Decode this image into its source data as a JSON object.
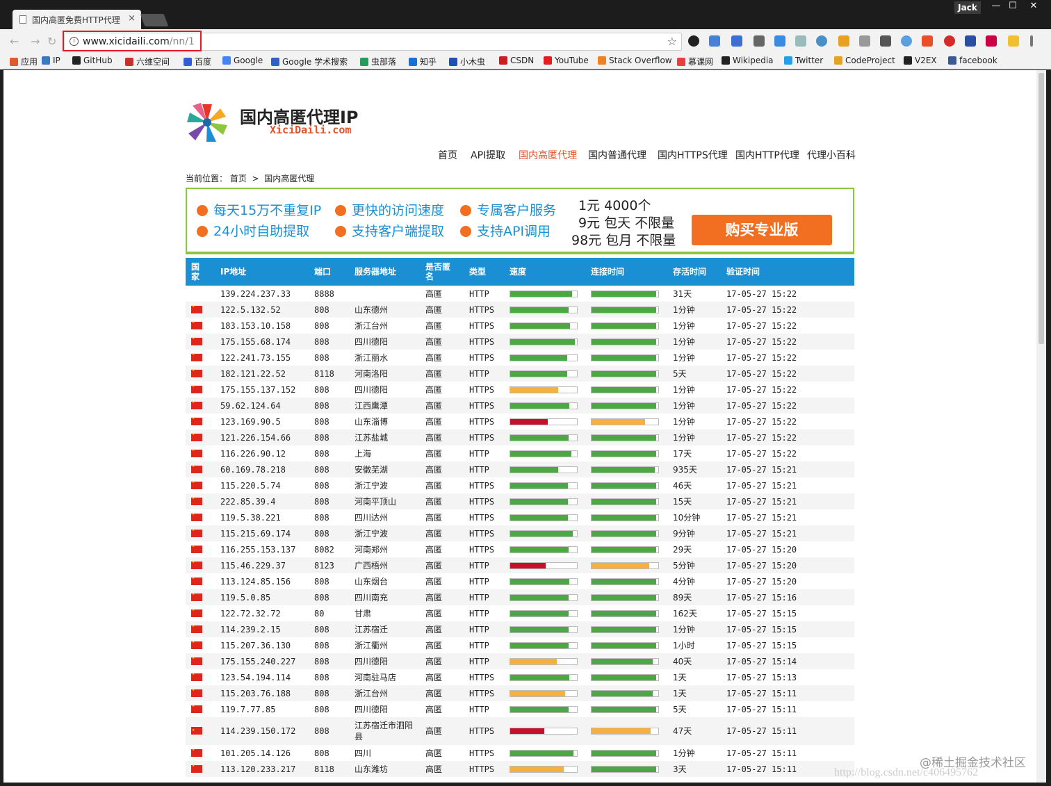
{
  "browser": {
    "tab_title": "国内高匿免费HTTP代理",
    "user": "Jack",
    "url_host": "www.xicidaili.com",
    "url_path": "/nn/1",
    "window_buttons": [
      "—",
      "☐",
      "✕"
    ],
    "bookmarks": [
      "应用",
      "IP",
      "GitHub",
      "六维空间",
      "百度",
      "Google",
      "Google 学术搜索",
      "虫部落",
      "知乎",
      "小木虫",
      "CSDN",
      "YouTube",
      "Stack Overflow",
      "慕课网",
      "Wikipedia",
      "Twitter",
      "CodeProject",
      "V2EX",
      "facebook"
    ]
  },
  "site": {
    "title": "国内高匿代理IP",
    "subtitle": "XiciDaili.com",
    "nav": [
      "首页",
      "API提取",
      "国内高匿代理",
      "国内普通代理",
      "国内HTTPS代理",
      "国内HTTP代理",
      "代理小百科"
    ],
    "breadcrumb_label": "当前位置：",
    "breadcrumb_home": "首页",
    "breadcrumb_sep": ">",
    "breadcrumb_current": "国内高匿代理"
  },
  "banner": {
    "features": [
      "每天15万不重复IP",
      "更快的访问速度",
      "专属客户服务",
      "24小时自助提取",
      "支持客户端提取",
      "支持API调用"
    ],
    "prices": [
      "1元 4000个",
      "9元 包天 不限量",
      "98元 包月 不限量"
    ],
    "buy_label": "购买专业版"
  },
  "table": {
    "headers": [
      "国家",
      "IP地址",
      "端口",
      "服务器地址",
      "是否匿名",
      "类型",
      "速度",
      "连接时间",
      "存活时间",
      "验证时间"
    ],
    "rows": [
      {
        "flag": false,
        "ip": "139.224.237.33",
        "port": "8888",
        "loc": "",
        "anon": "高匿",
        "type": "HTTP",
        "speed": 0.93,
        "speed_color": "green",
        "conn": 0.97,
        "conn_color": "green",
        "alive": "31天",
        "verified": "17-05-27 15:22"
      },
      {
        "flag": true,
        "ip": "122.5.132.52",
        "port": "808",
        "loc": "山东德州",
        "anon": "高匿",
        "type": "HTTPS",
        "speed": 0.88,
        "speed_color": "green",
        "conn": 0.97,
        "conn_color": "green",
        "alive": "1分钟",
        "verified": "17-05-27 15:22"
      },
      {
        "flag": true,
        "ip": "183.153.10.158",
        "port": "808",
        "loc": "浙江台州",
        "anon": "高匿",
        "type": "HTTPS",
        "speed": 0.9,
        "speed_color": "green",
        "conn": 0.97,
        "conn_color": "green",
        "alive": "1分钟",
        "verified": "17-05-27 15:22"
      },
      {
        "flag": true,
        "ip": "175.155.68.174",
        "port": "808",
        "loc": "四川德阳",
        "anon": "高匿",
        "type": "HTTPS",
        "speed": 0.97,
        "speed_color": "green",
        "conn": 0.97,
        "conn_color": "green",
        "alive": "1分钟",
        "verified": "17-05-27 15:22"
      },
      {
        "flag": true,
        "ip": "122.241.73.155",
        "port": "808",
        "loc": "浙江丽水",
        "anon": "高匿",
        "type": "HTTPS",
        "speed": 0.85,
        "speed_color": "green",
        "conn": 0.97,
        "conn_color": "green",
        "alive": "1分钟",
        "verified": "17-05-27 15:22"
      },
      {
        "flag": true,
        "ip": "182.121.22.52",
        "port": "8118",
        "loc": "河南洛阳",
        "anon": "高匿",
        "type": "HTTP",
        "speed": 0.85,
        "speed_color": "green",
        "conn": 0.97,
        "conn_color": "green",
        "alive": "5天",
        "verified": "17-05-27 15:22"
      },
      {
        "flag": true,
        "ip": "175.155.137.152",
        "port": "808",
        "loc": "四川德阳",
        "anon": "高匿",
        "type": "HTTPS",
        "speed": 0.72,
        "speed_color": "orange",
        "conn": 0.97,
        "conn_color": "green",
        "alive": "1分钟",
        "verified": "17-05-27 15:22"
      },
      {
        "flag": true,
        "ip": "59.62.124.64",
        "port": "808",
        "loc": "江西鹰潭",
        "anon": "高匿",
        "type": "HTTPS",
        "speed": 0.89,
        "speed_color": "green",
        "conn": 0.97,
        "conn_color": "green",
        "alive": "1分钟",
        "verified": "17-05-27 15:22"
      },
      {
        "flag": true,
        "ip": "123.169.90.5",
        "port": "808",
        "loc": "山东淄博",
        "anon": "高匿",
        "type": "HTTPS",
        "speed": 0.56,
        "speed_color": "red",
        "conn": 0.8,
        "conn_color": "orange",
        "alive": "1分钟",
        "verified": "17-05-27 15:22"
      },
      {
        "flag": true,
        "ip": "121.226.154.66",
        "port": "808",
        "loc": "江苏盐城",
        "anon": "高匿",
        "type": "HTTPS",
        "speed": 0.87,
        "speed_color": "green",
        "conn": 0.97,
        "conn_color": "green",
        "alive": "1分钟",
        "verified": "17-05-27 15:22"
      },
      {
        "flag": true,
        "ip": "116.226.90.12",
        "port": "808",
        "loc": "上海",
        "anon": "高匿",
        "type": "HTTP",
        "speed": 0.92,
        "speed_color": "green",
        "conn": 0.97,
        "conn_color": "green",
        "alive": "17天",
        "verified": "17-05-27 15:22"
      },
      {
        "flag": true,
        "ip": "60.169.78.218",
        "port": "808",
        "loc": "安徽芜湖",
        "anon": "高匿",
        "type": "HTTP",
        "speed": 0.72,
        "speed_color": "green",
        "conn": 0.95,
        "conn_color": "green",
        "alive": "935天",
        "verified": "17-05-27 15:21"
      },
      {
        "flag": true,
        "ip": "115.220.5.74",
        "port": "808",
        "loc": "浙江宁波",
        "anon": "高匿",
        "type": "HTTPS",
        "speed": 0.86,
        "speed_color": "green",
        "conn": 0.97,
        "conn_color": "green",
        "alive": "46天",
        "verified": "17-05-27 15:21"
      },
      {
        "flag": true,
        "ip": "222.85.39.4",
        "port": "808",
        "loc": "河南平顶山",
        "anon": "高匿",
        "type": "HTTPS",
        "speed": 0.86,
        "speed_color": "green",
        "conn": 0.97,
        "conn_color": "green",
        "alive": "15天",
        "verified": "17-05-27 15:21"
      },
      {
        "flag": true,
        "ip": "119.5.38.221",
        "port": "808",
        "loc": "四川达州",
        "anon": "高匿",
        "type": "HTTPS",
        "speed": 0.86,
        "speed_color": "green",
        "conn": 0.97,
        "conn_color": "green",
        "alive": "10分钟",
        "verified": "17-05-27 15:21"
      },
      {
        "flag": true,
        "ip": "115.215.69.174",
        "port": "808",
        "loc": "浙江宁波",
        "anon": "高匿",
        "type": "HTTPS",
        "speed": 0.94,
        "speed_color": "green",
        "conn": 0.97,
        "conn_color": "green",
        "alive": "9分钟",
        "verified": "17-05-27 15:21"
      },
      {
        "flag": true,
        "ip": "116.255.153.137",
        "port": "8082",
        "loc": "河南郑州",
        "anon": "高匿",
        "type": "HTTPS",
        "speed": 0.88,
        "speed_color": "green",
        "conn": 0.97,
        "conn_color": "green",
        "alive": "29天",
        "verified": "17-05-27 15:20"
      },
      {
        "flag": true,
        "ip": "115.46.229.37",
        "port": "8123",
        "loc": "广西梧州",
        "anon": "高匿",
        "type": "HTTP",
        "speed": 0.53,
        "speed_color": "red",
        "conn": 0.86,
        "conn_color": "orange",
        "alive": "5分钟",
        "verified": "17-05-27 15:20"
      },
      {
        "flag": true,
        "ip": "113.124.85.156",
        "port": "808",
        "loc": "山东烟台",
        "anon": "高匿",
        "type": "HTTP",
        "speed": 0.89,
        "speed_color": "green",
        "conn": 0.97,
        "conn_color": "green",
        "alive": "4分钟",
        "verified": "17-05-27 15:20"
      },
      {
        "flag": true,
        "ip": "119.5.0.85",
        "port": "808",
        "loc": "四川南充",
        "anon": "高匿",
        "type": "HTTP",
        "speed": 0.88,
        "speed_color": "green",
        "conn": 0.97,
        "conn_color": "green",
        "alive": "89天",
        "verified": "17-05-27 15:16"
      },
      {
        "flag": true,
        "ip": "122.72.32.72",
        "port": "80",
        "loc": "甘肃",
        "anon": "高匿",
        "type": "HTTP",
        "speed": 0.87,
        "speed_color": "green",
        "conn": 0.97,
        "conn_color": "green",
        "alive": "162天",
        "verified": "17-05-27 15:15"
      },
      {
        "flag": true,
        "ip": "114.239.2.15",
        "port": "808",
        "loc": "江苏宿迁",
        "anon": "高匿",
        "type": "HTTP",
        "speed": 0.87,
        "speed_color": "green",
        "conn": 0.97,
        "conn_color": "green",
        "alive": "1分钟",
        "verified": "17-05-27 15:15"
      },
      {
        "flag": true,
        "ip": "115.207.36.130",
        "port": "808",
        "loc": "浙江衢州",
        "anon": "高匿",
        "type": "HTTP",
        "speed": 0.87,
        "speed_color": "green",
        "conn": 0.97,
        "conn_color": "green",
        "alive": "1小时",
        "verified": "17-05-27 15:15"
      },
      {
        "flag": true,
        "ip": "175.155.240.227",
        "port": "808",
        "loc": "四川德阳",
        "anon": "高匿",
        "type": "HTTP",
        "speed": 0.7,
        "speed_color": "orange",
        "conn": 0.92,
        "conn_color": "green",
        "alive": "40天",
        "verified": "17-05-27 15:14"
      },
      {
        "flag": true,
        "ip": "123.54.194.114",
        "port": "808",
        "loc": "河南驻马店",
        "anon": "高匿",
        "type": "HTTPS",
        "speed": 0.89,
        "speed_color": "green",
        "conn": 0.97,
        "conn_color": "green",
        "alive": "1天",
        "verified": "17-05-27 15:13"
      },
      {
        "flag": true,
        "ip": "115.203.76.188",
        "port": "808",
        "loc": "浙江台州",
        "anon": "高匿",
        "type": "HTTPS",
        "speed": 0.82,
        "speed_color": "orange",
        "conn": 0.92,
        "conn_color": "green",
        "alive": "1天",
        "verified": "17-05-27 15:11"
      },
      {
        "flag": true,
        "ip": "119.7.77.85",
        "port": "808",
        "loc": "四川德阳",
        "anon": "高匿",
        "type": "HTTP",
        "speed": 0.87,
        "speed_color": "green",
        "conn": 0.97,
        "conn_color": "green",
        "alive": "5天",
        "verified": "17-05-27 15:11"
      },
      {
        "flag": true,
        "ip": "114.239.150.172",
        "port": "808",
        "loc": "江苏宿迁市泗阳县",
        "anon": "高匿",
        "type": "HTTPS",
        "speed": 0.51,
        "speed_color": "red",
        "conn": 0.89,
        "conn_color": "orange",
        "alive": "47天",
        "verified": "17-05-27 15:11",
        "tall": true
      },
      {
        "flag": true,
        "ip": "101.205.14.126",
        "port": "808",
        "loc": "四川",
        "anon": "高匿",
        "type": "HTTPS",
        "speed": 0.95,
        "speed_color": "green",
        "conn": 0.97,
        "conn_color": "green",
        "alive": "1分钟",
        "verified": "17-05-27 15:11"
      },
      {
        "flag": true,
        "ip": "113.120.233.217",
        "port": "8118",
        "loc": "山东潍坊",
        "anon": "高匿",
        "type": "HTTPS",
        "speed": 0.8,
        "speed_color": "orange",
        "conn": 0.97,
        "conn_color": "green",
        "alive": "3天",
        "verified": "17-05-27 15:11"
      }
    ]
  },
  "colors": {
    "green": "#4ca843",
    "orange": "#f7b03f",
    "red": "#c5102b",
    "accent": "#1a8fd3",
    "brand_orange": "#f26f21"
  },
  "watermark": "@稀土掘金技术社区",
  "watermark2": "http://blog.csdn.net/c406495762"
}
